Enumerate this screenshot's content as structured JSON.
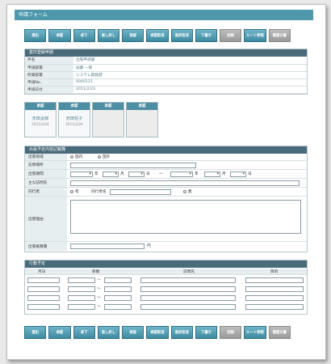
{
  "window": {
    "title": "申請フォーム"
  },
  "toolbar": {
    "buttons": [
      {
        "label": "提出",
        "enabled": true
      },
      {
        "label": "承認",
        "enabled": true
      },
      {
        "label": "却下",
        "enabled": true
      },
      {
        "label": "差し戻し",
        "enabled": true
      },
      {
        "label": "保留",
        "enabled": true
      },
      {
        "label": "承認取消",
        "enabled": true
      },
      {
        "label": "差戻取消",
        "enabled": true
      },
      {
        "label": "下書き",
        "enabled": true
      },
      {
        "label": "削除",
        "enabled": false
      },
      {
        "label": "ルート参照",
        "enabled": true
      },
      {
        "label": "関連文書",
        "enabled": false
      }
    ]
  },
  "case_info": {
    "heading": "案件登録申請",
    "rows": [
      {
        "label": "件名",
        "value": "出張申請書"
      },
      {
        "label": "申請部署",
        "value": "加藤 一郎"
      },
      {
        "label": "所属部署",
        "value": "システム開発部"
      },
      {
        "label": "申請No.",
        "value": "0000121"
      },
      {
        "label": "申請日付",
        "value": "2011/2/23"
      }
    ]
  },
  "approvals": [
    {
      "header": "承認",
      "name": "天田太郎",
      "date": "2011/2/24"
    },
    {
      "header": "承認",
      "name": "天田花子",
      "date": "2011/2/24"
    },
    {
      "header": "承認",
      "name": "",
      "date": ""
    },
    {
      "header": "承認",
      "name": "",
      "date": ""
    }
  ],
  "trip": {
    "heading": "出張予定内容記載欄",
    "region_label": "出張地域",
    "region_options": [
      "国内",
      "国外"
    ],
    "destination_label": "訪問場所",
    "period_label": "出張期間",
    "period_units": [
      "年",
      "月",
      "日",
      "〜",
      "年",
      "月",
      "日"
    ],
    "main_visit_label": "主な訪問先",
    "companion_label": "同行者",
    "companion_yes": "有",
    "companion_name_label": "同行者名",
    "companion_no": "無",
    "reason_label": "出張理由",
    "cost_label": "出張概算費",
    "cost_unit": "円"
  },
  "schedule": {
    "heading": "行動予定",
    "columns": [
      "月日",
      "移動",
      "訪問先",
      "目的"
    ],
    "range_sep": "〜",
    "row_count": 4
  }
}
